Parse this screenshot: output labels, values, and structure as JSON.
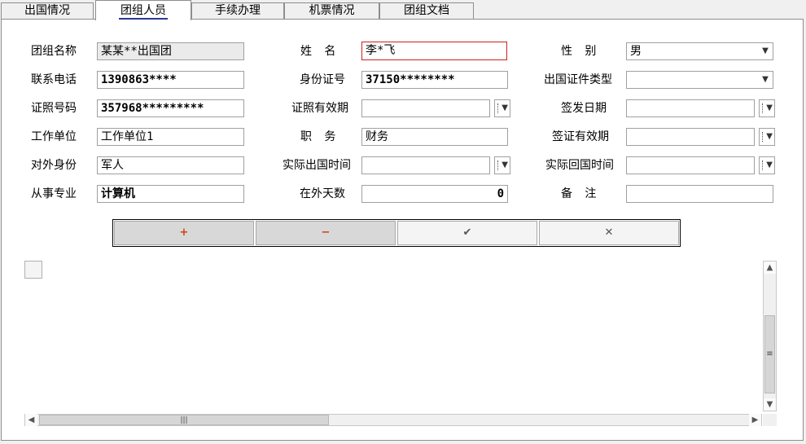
{
  "tabs": [
    {
      "label": "出国情况"
    },
    {
      "label": "团组人员"
    },
    {
      "label": "手续办理"
    },
    {
      "label": "机票情况"
    },
    {
      "label": "团组文档"
    }
  ],
  "form": {
    "group_name": {
      "label": "团组名称",
      "value": "某某**出国团"
    },
    "name": {
      "label": "姓名",
      "value": "李*飞"
    },
    "gender": {
      "label": "性别",
      "value": "男"
    },
    "phone": {
      "label": "联系电话",
      "value": "1390863****"
    },
    "id_number": {
      "label": "身份证号",
      "value": "37150********"
    },
    "cert_type": {
      "label": "出国证件类型",
      "value": ""
    },
    "cert_number": {
      "label": "证照号码",
      "value": "357968*********"
    },
    "cert_valid": {
      "label": "证照有效期",
      "value": ""
    },
    "issue_date": {
      "label": "签发日期",
      "value": ""
    },
    "work_unit": {
      "label": "工作单位",
      "value": "工作单位1"
    },
    "position": {
      "label": "职务",
      "value": "财务"
    },
    "visa_valid": {
      "label": "签证有效期",
      "value": ""
    },
    "external_identity": {
      "label": "对外身份",
      "value": "军人"
    },
    "actual_departure": {
      "label": "实际出国时间",
      "value": ""
    },
    "actual_return": {
      "label": "实际回国时间",
      "value": ""
    },
    "profession": {
      "label": "从事专业",
      "value": "计算机"
    },
    "days_abroad": {
      "label": "在外天数",
      "value": "0"
    },
    "remarks": {
      "label": "备注",
      "value": ""
    }
  },
  "toolbar": {
    "add": "+",
    "remove": "−",
    "confirm": "✔",
    "cancel": "✕"
  },
  "colors": {
    "active_tab_underline": "#2a3a8f",
    "focus_border": "#d02020",
    "toolbar_accent": "#d04010"
  }
}
